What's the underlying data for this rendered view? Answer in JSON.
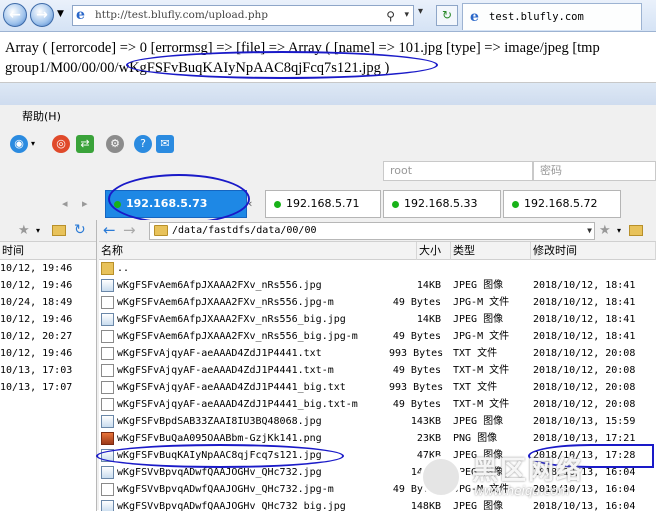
{
  "browser": {
    "address": "http://test.blufly.com/upload.php",
    "tab_title": "test.blufly.com",
    "back_glyph": "←",
    "forward_glyph": "→",
    "refresh_glyph": "↻"
  },
  "output": {
    "line1": "Array ( [errorcode] => 0 [errormsg] => [file] => Array ( [name] => 101.jpg [type] => image/jpeg [tmp",
    "line2_prefix": "group1/M00/00/00/",
    "line2_highlight": "wKgFSFvBuqKAIyNpAAC8qjFcq7s121.jpg )"
  },
  "app": {
    "menu": {
      "help": "帮助(H)"
    },
    "connection": {
      "host_placeholder": "root",
      "password_placeholder": "密码"
    },
    "sessions": [
      {
        "label": "192.168.5.73",
        "active": true
      },
      {
        "label": "192.168.5.71",
        "active": false
      },
      {
        "label": "192.168.5.33",
        "active": false
      },
      {
        "label": "192.168.5.72",
        "active": false
      }
    ],
    "left_pane": {
      "column": "时间",
      "rows": [
        "10/12, 19:46",
        "10/12, 19:46",
        "10/24, 18:49",
        "10/12, 19:46",
        "10/12, 20:27",
        "10/12, 19:46",
        "10/13, 17:03",
        "10/13, 17:07"
      ]
    },
    "right_pane": {
      "path": "/data/fastdfs/data/00/00",
      "columns": {
        "name": "名称",
        "size": "大小",
        "type": "类型",
        "modified": "修改时间"
      },
      "parent": "..",
      "files": [
        {
          "name": "wKgFSFvAem6AfpJXAAA2FXv_nRs556.jpg",
          "size": "14KB",
          "type": "JPEG 图像",
          "modified": "2018/10/12, 18:41",
          "icon": "image"
        },
        {
          "name": "wKgFSFvAem6AfpJXAAA2FXv_nRs556.jpg-m",
          "size": "49 Bytes",
          "type": "JPG-M 文件",
          "modified": "2018/10/12, 18:41",
          "icon": "text"
        },
        {
          "name": "wKgFSFvAem6AfpJXAAA2FXv_nRs556_big.jpg",
          "size": "14KB",
          "type": "JPEG 图像",
          "modified": "2018/10/12, 18:41",
          "icon": "image"
        },
        {
          "name": "wKgFSFvAem6AfpJXAAA2FXv_nRs556_big.jpg-m",
          "size": "49 Bytes",
          "type": "JPG-M 文件",
          "modified": "2018/10/12, 18:41",
          "icon": "text"
        },
        {
          "name": "wKgFSFvAjqyAF-aeAAAD4ZdJ1P4441.txt",
          "size": "993 Bytes",
          "type": "TXT 文件",
          "modified": "2018/10/12, 20:08",
          "icon": "text"
        },
        {
          "name": "wKgFSFvAjqyAF-aeAAAD4ZdJ1P4441.txt-m",
          "size": "49 Bytes",
          "type": "TXT-M 文件",
          "modified": "2018/10/12, 20:08",
          "icon": "text"
        },
        {
          "name": "wKgFSFvAjqyAF-aeAAAD4ZdJ1P4441_big.txt",
          "size": "993 Bytes",
          "type": "TXT 文件",
          "modified": "2018/10/12, 20:08",
          "icon": "text"
        },
        {
          "name": "wKgFSFvAjqyAF-aeAAAD4ZdJ1P4441_big.txt-m",
          "size": "49 Bytes",
          "type": "TXT-M 文件",
          "modified": "2018/10/12, 20:08",
          "icon": "text"
        },
        {
          "name": "wKgFSFvBpdSAB33ZAAI8IU3BQ48068.jpg",
          "size": "143KB",
          "type": "JPEG 图像",
          "modified": "2018/10/13, 15:59",
          "icon": "image"
        },
        {
          "name": "wKgFSFvBuQaA095OAABbm-GzjKk141.png",
          "size": "23KB",
          "type": "PNG 图像",
          "modified": "2018/10/13, 17:21",
          "icon": "png"
        },
        {
          "name": "wKgFSFvBuqKAIyNpAAC8qjFcq7s121.jpg",
          "size": "47KB",
          "type": "JPEG 图像",
          "modified": "2018/10/13, 17:28",
          "icon": "image"
        },
        {
          "name": "wKgFSVvBpvqADwfQAAJOGHv_QHc732.jpg",
          "size": "148KB",
          "type": "JPEG 图像",
          "modified": "2018/10/13, 16:04",
          "icon": "image"
        },
        {
          "name": "wKgFSVvBpvqADwfQAAJOGHv_QHc732.jpg-m",
          "size": "49 Bytes",
          "type": "JPG-M 文件",
          "modified": "2018/10/13, 16:04",
          "icon": "text"
        },
        {
          "name": "wKgFSVvBpvqADwfQAAJOGHv_QHc732_big.jpg",
          "size": "148KB",
          "type": "JPEG 图像",
          "modified": "2018/10/13, 16:04",
          "icon": "image"
        }
      ]
    }
  },
  "watermark": {
    "text": "黑区网络",
    "url": "www.heiqu.com"
  }
}
